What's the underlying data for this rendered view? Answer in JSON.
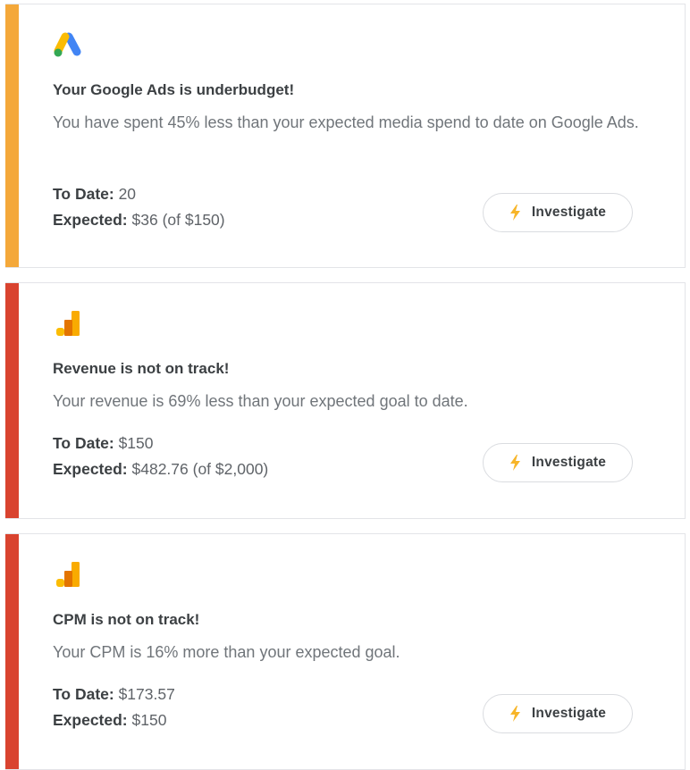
{
  "colors": {
    "warning_accent": "#f4a83a",
    "error_accent": "#d9432f",
    "bolt": "#f7b529"
  },
  "alerts": [
    {
      "icon": "google-ads-icon",
      "severity": "warning",
      "title": "Your Google Ads is underbudget!",
      "description": "You have spent 45% less than your expected media spend to date on Google Ads.",
      "to_date_label": "To Date:",
      "to_date_value": " 20",
      "expected_label": "Expected:",
      "expected_value": " $36 (of $150)",
      "button_label": "Investigate"
    },
    {
      "icon": "google-analytics-icon",
      "severity": "error",
      "title": "Revenue is not on track!",
      "description": "Your revenue is 69% less than your expected goal to date.",
      "to_date_label": "To Date:",
      "to_date_value": " $150",
      "expected_label": "Expected:",
      "expected_value": " $482.76 (of $2,000)",
      "button_label": "Investigate"
    },
    {
      "icon": "google-analytics-icon",
      "severity": "error",
      "title": "CPM is not on track!",
      "description": "Your CPM is 16% more than your expected goal.",
      "to_date_label": "To Date:",
      "to_date_value": " $173.57",
      "expected_label": "Expected:",
      "expected_value": " $150",
      "button_label": "Investigate"
    }
  ]
}
